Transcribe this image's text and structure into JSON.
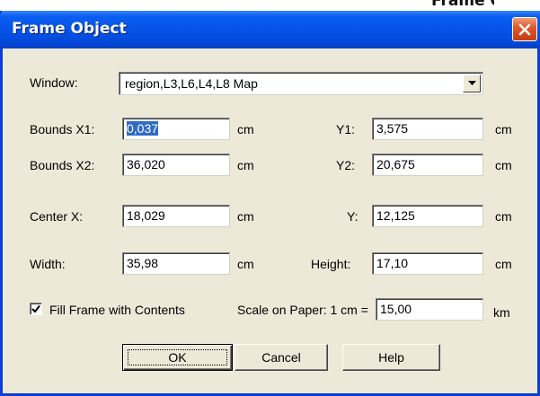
{
  "top_clip_text": "Frame Object",
  "window": {
    "title": "Frame Object"
  },
  "window_row": {
    "label": "Window:",
    "selected": "region,L3,L6,L4,L8 Map"
  },
  "bounds1": {
    "label": "Bounds X1:",
    "x1": "0,037",
    "x1_unit": "cm",
    "y_label": "Y1:",
    "y1": "3,575",
    "y1_unit": "cm"
  },
  "bounds2": {
    "label": "Bounds X2:",
    "x2": "36,020",
    "x2_unit": "cm",
    "y_label": "Y2:",
    "y2": "20,675",
    "y2_unit": "cm"
  },
  "center": {
    "label": "Center X:",
    "x": "18,029",
    "x_unit": "cm",
    "y_label": "Y:",
    "y": "12,125",
    "y_unit": "cm"
  },
  "size": {
    "width_label": "Width:",
    "width": "35,98",
    "width_unit": "cm",
    "height_label": "Height:",
    "height": "17,10",
    "height_unit": "cm"
  },
  "fill": {
    "label": "Fill Frame with Contents",
    "checked": true
  },
  "scale": {
    "label": "Scale on Paper: 1 cm =",
    "value": "15,00",
    "unit": "km"
  },
  "buttons": {
    "ok": "OK",
    "cancel": "Cancel",
    "help": "Help"
  },
  "colors": {
    "titlebar": "#0552e6",
    "dialog_bg": "#ece9d8",
    "selection": "#316ac5",
    "close": "#e05a2a"
  }
}
